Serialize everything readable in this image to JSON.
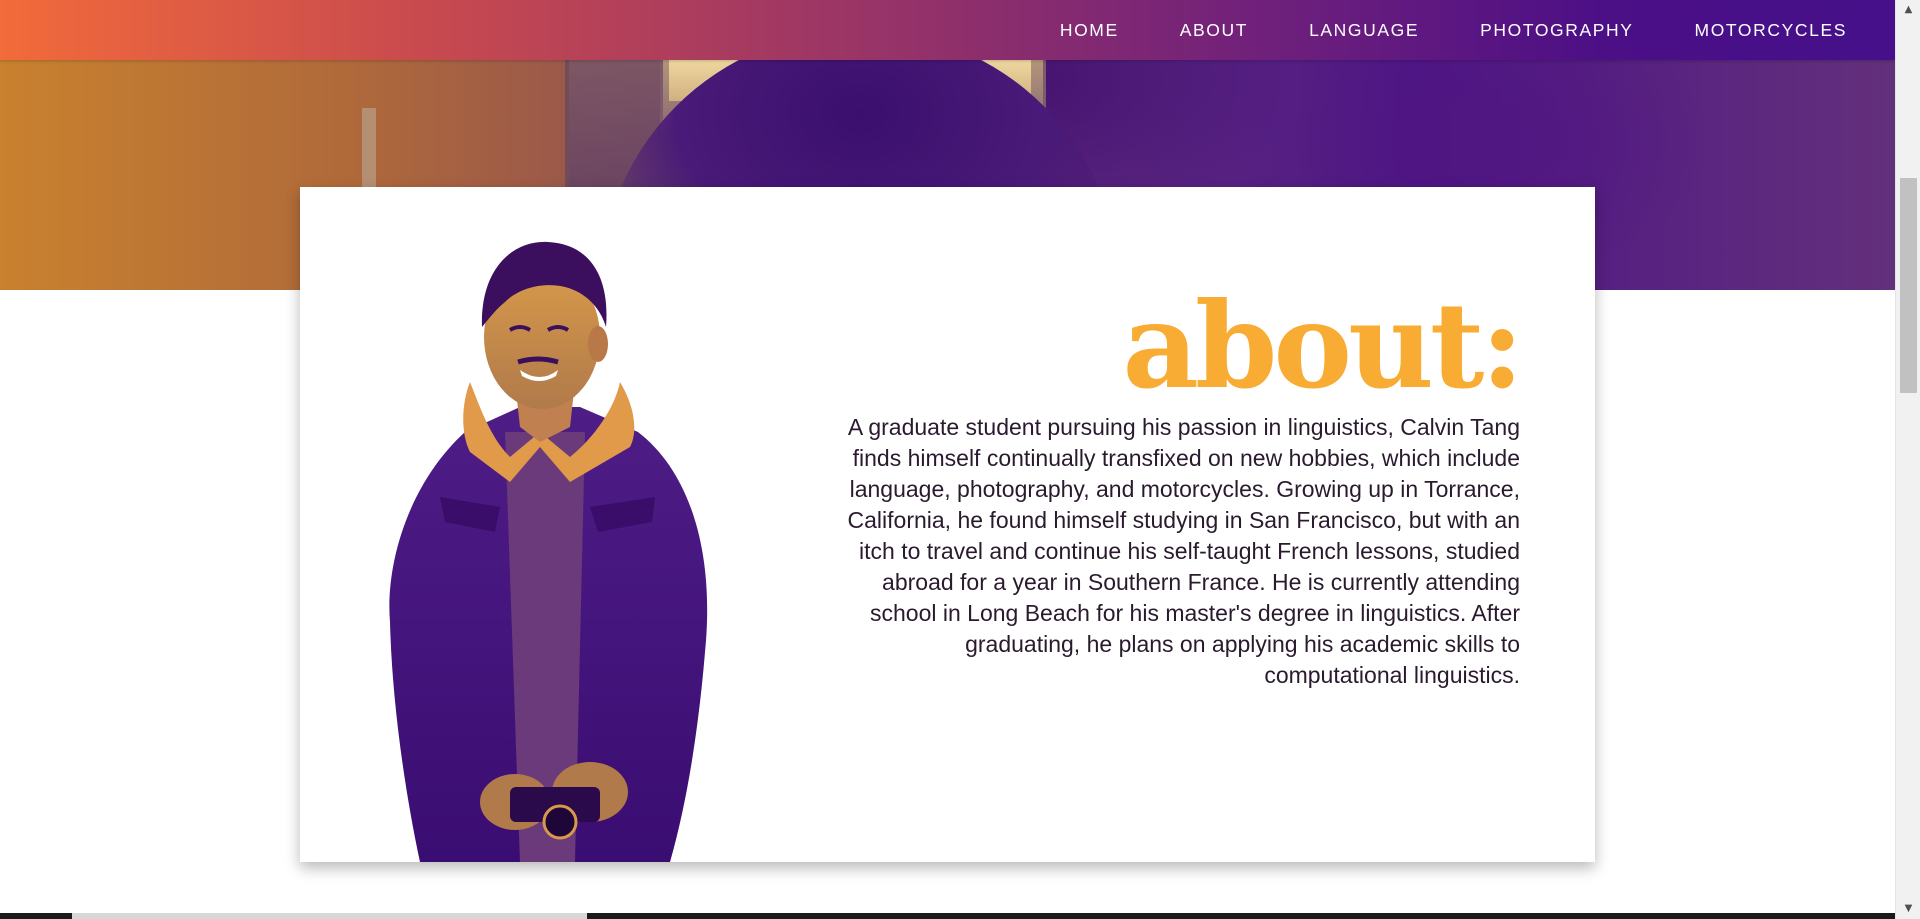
{
  "nav": {
    "items": [
      {
        "label": "HOME"
      },
      {
        "label": "ABOUT"
      },
      {
        "label": "LANGUAGE"
      },
      {
        "label": "PHOTOGRAPHY"
      },
      {
        "label": "MOTORCYCLES"
      }
    ]
  },
  "about": {
    "heading": "about:",
    "bio": "A graduate student pursuing his passion in linguistics, Calvin Tang finds himself continually transfixed on new hobbies, which include language, photography, and motorcycles. Growing up in Torrance, California, he found himself studying in San Francisco, but with an itch to travel and continue his self-taught French lessons, studied abroad for a year in Southern France. He is currently attending school in Long Beach for his master's degree in linguistics. After graduating, he plans on applying his academic skills to computational linguistics."
  },
  "scrollbar": {
    "up_icon": "scroll-up-arrow-icon",
    "down_icon": "scroll-down-arrow-icon"
  },
  "colors": {
    "accent": "#f8ac33",
    "nav_start": "#f26b3a",
    "nav_end": "#45108a",
    "duotone_dark": "#4b0f86"
  }
}
